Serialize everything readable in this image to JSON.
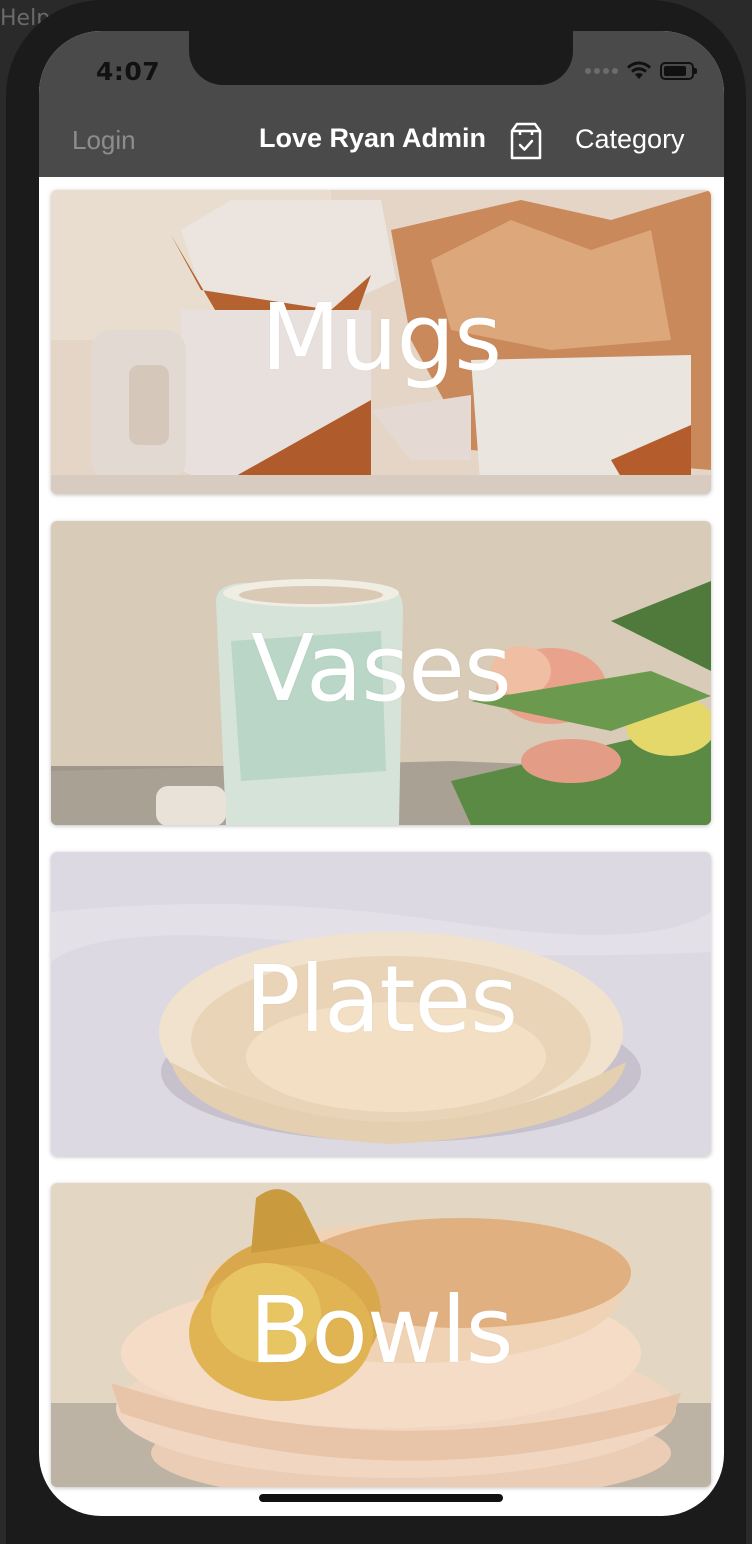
{
  "desktop": {
    "corner_text": "Help"
  },
  "status_bar": {
    "time": "4:07"
  },
  "nav": {
    "login_label": "Login",
    "title": "Love Ryan Admin",
    "cart_icon": "shopping-bag-icon",
    "category_label": "Category"
  },
  "categories": [
    {
      "label": "Mugs"
    },
    {
      "label": "Vases"
    },
    {
      "label": "Plates"
    },
    {
      "label": "Bowls"
    }
  ],
  "colors": {
    "nav_background": "#4a4a4a",
    "nav_text": "#ffffff",
    "login_text": "#8d8d8d",
    "label_text": "#ffffff"
  }
}
